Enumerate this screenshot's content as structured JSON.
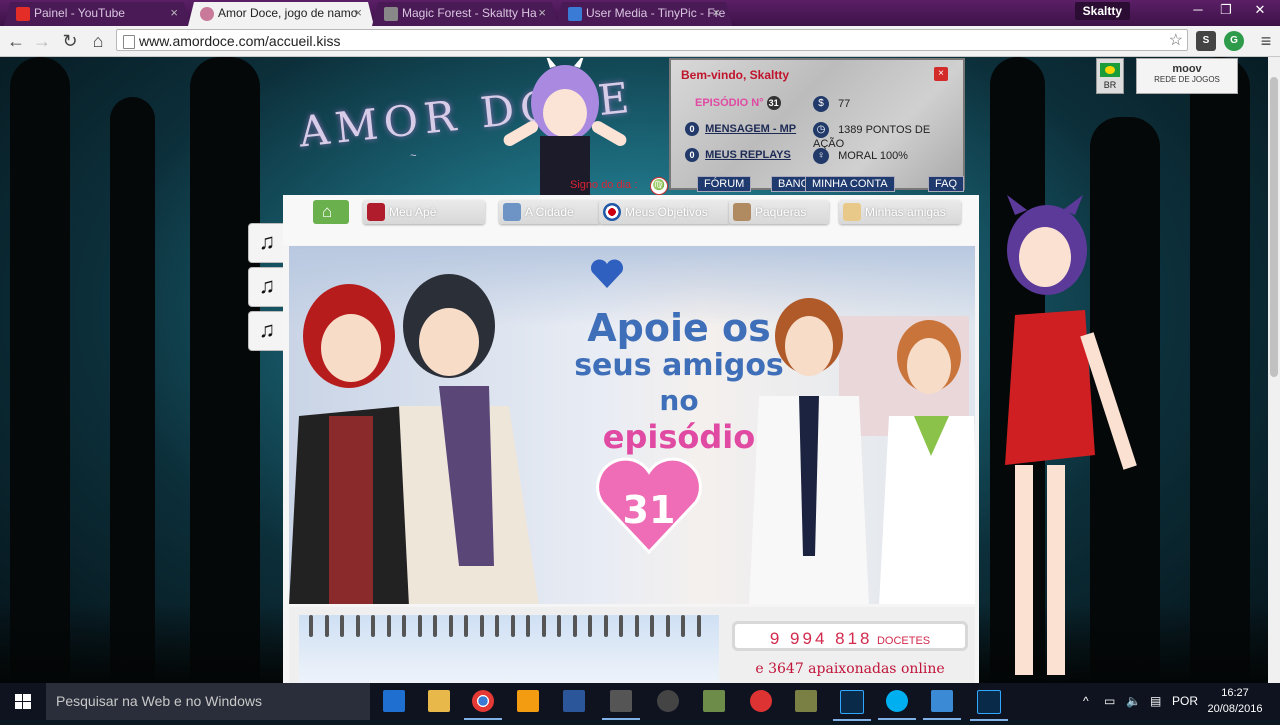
{
  "tabs": [
    {
      "label": "Painel - YouTube",
      "icon": "youtube-icon",
      "active": false
    },
    {
      "label": "Amor Doce, jogo de namo",
      "icon": "amordoce-icon",
      "active": true
    },
    {
      "label": "Magic Forest - Skaltty Ha",
      "icon": "skaltty-icon",
      "active": false
    },
    {
      "label": "User Media - TinyPic - Fre",
      "icon": "tinypic-icon",
      "active": false
    }
  ],
  "profile_name": "Skaltty",
  "address": {
    "url": "www.amordoce.com/accueil.kiss"
  },
  "header": {
    "logo_text": "AMOR DOCE",
    "signo_label": "Signo do dia :",
    "welcome": "Bem-vindo, Skaltty",
    "episode_label": "EPISÓDIO N°",
    "episode_number": "31",
    "messages_count": "0",
    "messages_link": "MENSAGEM - MP",
    "replays_count": "0",
    "replays_link": "MEUS REPLAYS",
    "money": "77",
    "action_points": "1389 PONTOS DE AÇÃO",
    "moral": "MORAL 100%",
    "buttons": {
      "forum": "FÓRUM",
      "bank": "BANCO",
      "account": "MINHA CONTA",
      "faq": "FAQ"
    },
    "flag_label": "BR",
    "network_name": "moov",
    "network_sub": "REDE DE JOGOS"
  },
  "nav": {
    "items": [
      {
        "label": "Meu Apê"
      },
      {
        "label": "A Cidade"
      },
      {
        "label": "Meus Objetivos"
      },
      {
        "label": "Paqueras"
      },
      {
        "label": "Minhas amigas"
      }
    ]
  },
  "banner": {
    "line1": "Apoie os",
    "line2": "seus amigos",
    "line3": "no",
    "line4": "episódio",
    "heart_number": "31"
  },
  "stats": {
    "players": "9 994 818",
    "players_unit": "DOCETES",
    "online": "e 3647 apaixonadas online"
  },
  "taskbar": {
    "search_placeholder": "Pesquisar na Web e no Windows",
    "lang": "POR",
    "time": "16:27",
    "date": "20/08/2016"
  },
  "colors": {
    "brand_pink": "#e04aa3",
    "brand_blue": "#3f6fb8",
    "title_red": "#c0142c"
  }
}
